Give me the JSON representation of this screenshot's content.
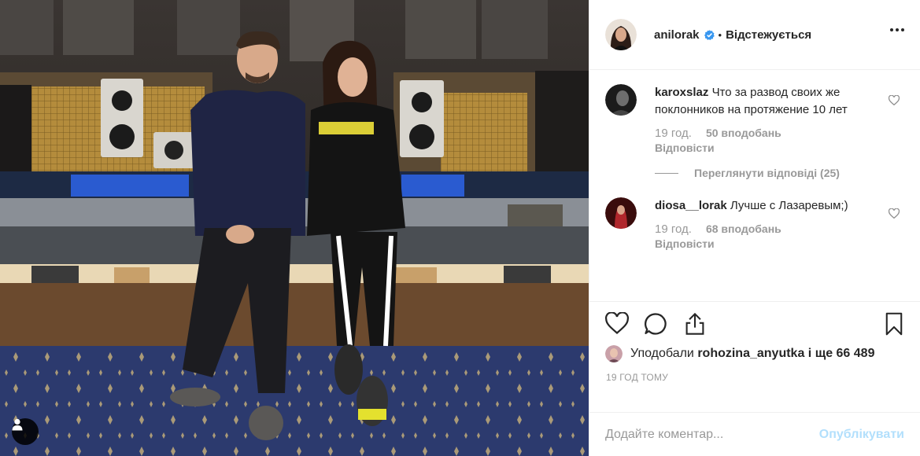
{
  "post": {
    "author": "anilorak",
    "separator": "•",
    "follow_status": "Відстежується",
    "icons": {
      "verified": "verified-badge-icon",
      "more": "more-options-icon",
      "tag": "user-tag-icon"
    }
  },
  "comments": [
    {
      "username": "karoxslaz",
      "text": "Что за развод своих же поклонников на протяжение 10 лет",
      "time": "19 год.",
      "likes": "50 вподобань",
      "reply_label": "Відповісти",
      "view_replies": "Переглянути відповіді (25)"
    },
    {
      "username": "diosa__lorak",
      "text": "Лучше с Лазаревым;)",
      "time": "19 год.",
      "likes": "68 вподобань",
      "reply_label": "Відповісти"
    }
  ],
  "actions": {
    "icons": [
      "heart-icon",
      "comment-icon",
      "share-icon",
      "bookmark-icon"
    ]
  },
  "likes_line": {
    "prefix": "Уподобали",
    "user": "rohozina_anyutka",
    "suffix": "і ще 66 489"
  },
  "timestamp": "19 ГОД ТОМУ",
  "add_comment": {
    "placeholder": "Додайте коментар...",
    "publish_label": "Опублікувати"
  },
  "colors": {
    "verified": "#3897f0",
    "publish_disabled": "#b2dffc",
    "muted": "#999999"
  }
}
